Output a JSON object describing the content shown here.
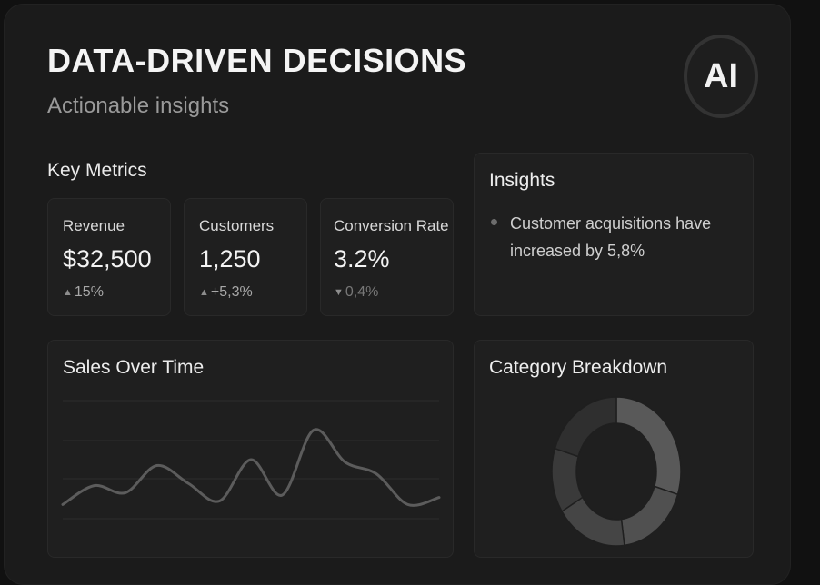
{
  "header": {
    "title": "DATA-DRIVEN DECISIONS",
    "subtitle": "Actionable insights",
    "badge": "AI"
  },
  "key_metrics": {
    "label": "Key Metrics",
    "items": [
      {
        "name": "Revenue",
        "value": "$32,500",
        "delta": "15%",
        "trend": "up"
      },
      {
        "name": "Customers",
        "value": "1,250",
        "delta": "+5,3%",
        "trend": "up"
      },
      {
        "name": "Conversion Rate",
        "value": "3.2%",
        "delta": "0,4%",
        "trend": "down"
      }
    ]
  },
  "insights": {
    "title": "Insights",
    "items": [
      "Customer acquisitions have increased by 5,8%"
    ]
  },
  "sales": {
    "title": "Sales Over Time"
  },
  "category": {
    "title": "Category Breakdown"
  },
  "icons": {
    "up": "triangle-up-icon",
    "down": "triangle-down-icon",
    "bullet": "bullet-icon"
  },
  "colors": {
    "background": "#111111",
    "panel": "#1b1b1b",
    "card": "#1f1f1f",
    "text": "#e9e9e9",
    "muted": "#9a9a9a"
  },
  "chart_data": [
    {
      "type": "line",
      "title": "Sales Over Time",
      "series": [
        {
          "values": [
            12,
            28,
            22,
            45,
            30,
            15,
            50,
            20,
            75,
            48,
            38,
            12,
            18
          ]
        }
      ],
      "ylim": [
        0,
        100
      ],
      "grid": true
    },
    {
      "type": "pie",
      "title": "Category Breakdown",
      "values": [
        30,
        18,
        18,
        14,
        20
      ],
      "colors": [
        "#595959",
        "#505050",
        "#454545",
        "#3a3a3a",
        "#2f2f2f"
      ]
    }
  ]
}
